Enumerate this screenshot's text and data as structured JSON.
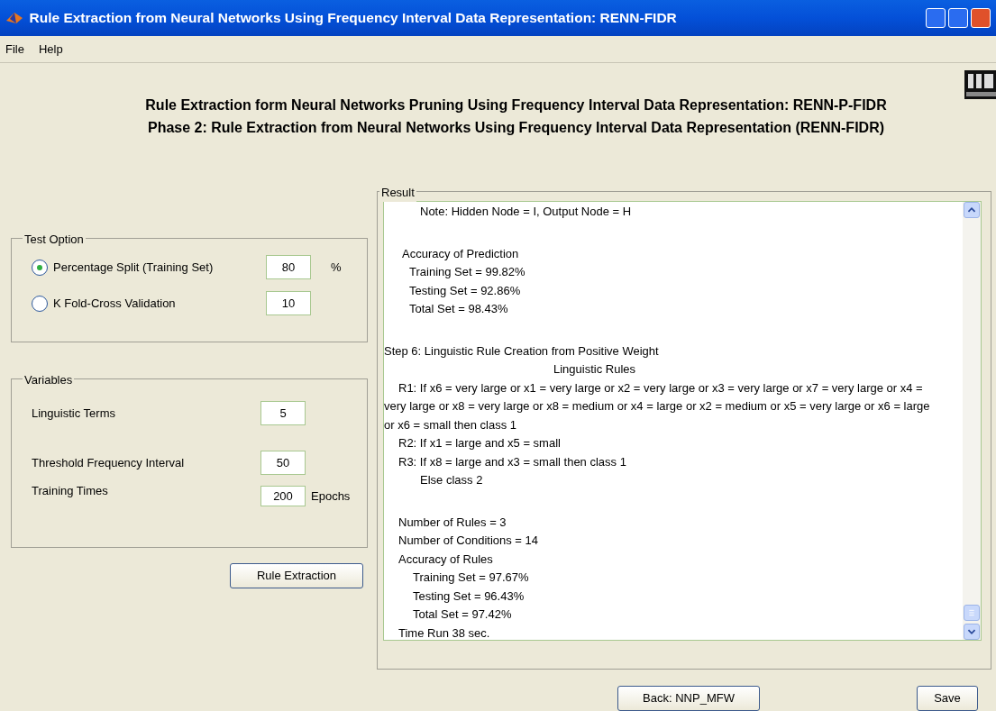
{
  "window": {
    "title": "Rule Extraction from Neural Networks Using Frequency Interval Data Representation: RENN-FIDR"
  },
  "menu": [
    "File",
    "Help"
  ],
  "headings": [
    "Rule Extraction form Neural Networks Pruning Using Frequency Interval Data Representation: RENN-P-FIDR",
    "Phase 2: Rule Extraction from Neural Networks Using Frequency Interval Data Representation (RENN-FIDR)"
  ],
  "test_option": {
    "title": "Test Option",
    "options": [
      {
        "label": "Percentage Split (Training Set)",
        "selected": true,
        "value": "80",
        "unit": "%"
      },
      {
        "label": "K Fold-Cross Validation",
        "selected": false,
        "value": "10"
      }
    ]
  },
  "variables": {
    "title": "Variables",
    "items": [
      {
        "label": "Linguistic Terms",
        "value": "5"
      },
      {
        "label": "Threshold Frequency Interval",
        "value": "50"
      },
      {
        "label": "Training Times",
        "value": "200",
        "unit": "Epochs"
      }
    ]
  },
  "rule_extraction_button": "Rule Extraction",
  "result": {
    "title": "Result",
    "lines": [
      {
        "kind": "note",
        "text": "Note: Hidden Node = I, Output Node = H"
      },
      {
        "kind": "group",
        "gap_before": true,
        "text": "Accuracy of Prediction"
      },
      {
        "kind": "value",
        "text": "Training Set = 99.82%"
      },
      {
        "kind": "value",
        "text": "Testing Set = 92.86%"
      },
      {
        "kind": "value",
        "text": "Total Set = 98.43%"
      },
      {
        "kind": "step",
        "gap_before": true,
        "text": "Step 6: Linguistic Rule Creation from Positive Weight"
      },
      {
        "kind": "title",
        "text": "Linguistic Rules"
      },
      {
        "kind": "rule",
        "text": "R1: If x6 = very large or x1 = very large or x2 = very large or x3 = very large or x7 = very large or x4 = very large or x8 = very large or x8 = medium or x4 = large or x2 = medium or x5 = very large or x6 = large or x6 = small then class 1"
      },
      {
        "kind": "rule",
        "text": "R2: If x1 = large and x5 = small"
      },
      {
        "kind": "rule",
        "text": "R3: If x8 = large and x3 = small then class 1"
      },
      {
        "kind": "note",
        "text": "Else class 2"
      },
      {
        "kind": "stat",
        "gap_before": true,
        "text": "Number of Rules = 3"
      },
      {
        "kind": "stat",
        "text": "Number of Conditions = 14"
      },
      {
        "kind": "stat",
        "text": "Accuracy of Rules"
      },
      {
        "kind": "stat_value",
        "text": "Training Set = 97.67%"
      },
      {
        "kind": "stat_value",
        "text": "Testing Set = 96.43%"
      },
      {
        "kind": "stat_value",
        "text": "Total Set = 97.42%"
      },
      {
        "kind": "stat",
        "text": "Time Run 38 sec."
      }
    ]
  },
  "footer_buttons": [
    "Back: NNP_MFW",
    "Save"
  ]
}
